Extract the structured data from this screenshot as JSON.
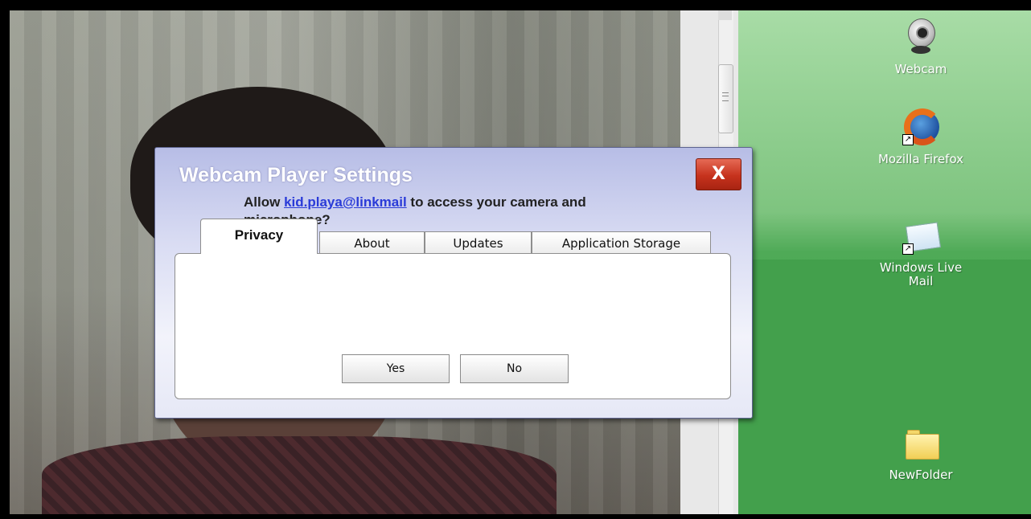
{
  "dialog": {
    "title": "Webcam Player Settings",
    "close_label": "X",
    "tabs": [
      {
        "label": "Privacy",
        "active": true
      },
      {
        "label": "About",
        "active": false
      },
      {
        "label": "Updates",
        "active": false
      },
      {
        "label": "Application Storage",
        "active": false
      }
    ],
    "message_prefix": "Allow ",
    "account_link": "kid.playa@linkmail",
    "message_suffix": " to access your camera and microphone?",
    "yes_label": "Yes",
    "no_label": "No"
  },
  "desktop": {
    "icons": [
      {
        "label": "Webcam",
        "icon": "webcam-icon"
      },
      {
        "label": "Mozilla Firefox",
        "icon": "firefox-icon"
      },
      {
        "label": "Windows Live Mail",
        "icon": "mail-icon"
      },
      {
        "label": "NewFolder",
        "icon": "folder-icon"
      }
    ]
  },
  "colors": {
    "dialog_gradient_top": "#b7bde6",
    "close_red": "#c6321d",
    "link_blue": "#2a3bd8",
    "desktop_green": "#43a04c"
  }
}
